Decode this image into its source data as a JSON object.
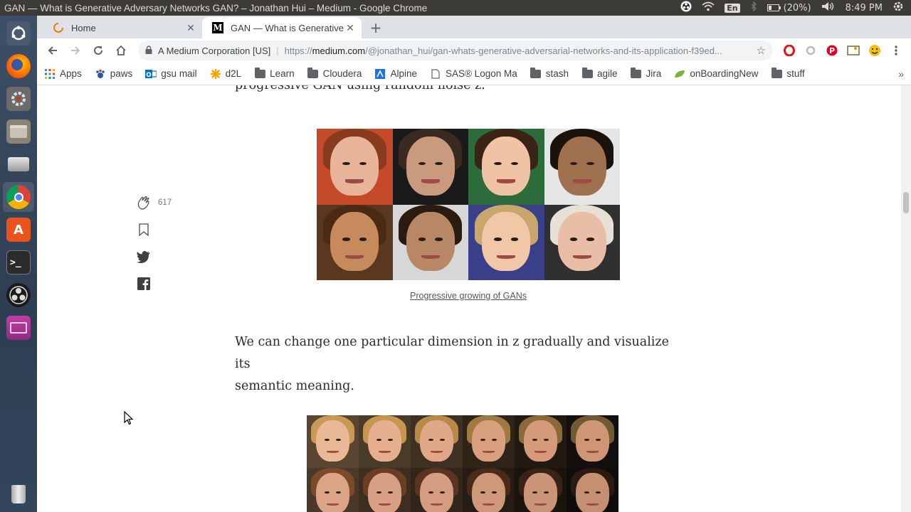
{
  "system": {
    "window_title": "GAN — What is Generative Adversary Networks GAN? – Jonathan Hui – Medium - Google Chrome",
    "language_indicator": "En",
    "battery": "(20%)",
    "clock": "8:49 PM"
  },
  "launcher": {
    "items": [
      "ubuntu-dash-icon",
      "firefox-icon",
      "system-settings-icon",
      "files-icon",
      "disks-icon",
      "chrome-icon",
      "software-center-icon",
      "terminal-icon",
      "obs-icon",
      "workspace-icon"
    ],
    "trash": "trash-icon"
  },
  "browser": {
    "tabs": [
      {
        "label": "Home",
        "active": false
      },
      {
        "label": "GAN — What is Generative Adversary Networks GAN?",
        "active": true
      }
    ],
    "new_tab": "+",
    "omnibox": {
      "cert": "A Medium Corporation [US]",
      "url_scheme": "https://",
      "url_host": "medium.com",
      "url_path": "/@jonathan_hui/gan-whats-generative-adversarial-networks-and-its-application-f39ed..."
    },
    "bookmarks": [
      {
        "label": "Apps",
        "icon": "apps-grid-icon"
      },
      {
        "label": "paws",
        "icon": "paws-icon"
      },
      {
        "label": "gsu mail",
        "icon": "outlook-icon"
      },
      {
        "label": "d2L",
        "icon": "d2l-icon"
      },
      {
        "label": "Learn",
        "icon": "folder-icon"
      },
      {
        "label": "Cloudera",
        "icon": "folder-icon"
      },
      {
        "label": "Alpine",
        "icon": "alpine-icon"
      },
      {
        "label": "SAS® Logon Ma",
        "icon": "page-icon"
      },
      {
        "label": "stash",
        "icon": "folder-icon"
      },
      {
        "label": "agile",
        "icon": "folder-icon"
      },
      {
        "label": "Jira",
        "icon": "folder-icon"
      },
      {
        "label": "onBoardingNew",
        "icon": "leaf-icon"
      },
      {
        "label": "stuff",
        "icon": "folder-icon"
      }
    ],
    "bookmarks_overflow": "»"
  },
  "article": {
    "text_top": "progressive GAN using random noise z.",
    "caption": "Progressive growing of GANs",
    "paragraph_line1": "We can change one particular dimension in z gradually and visualize its",
    "paragraph_line2": "semantic meaning."
  },
  "share_bar": {
    "clap_count": "617"
  },
  "colors": {
    "panel": "#3c3b37",
    "tabstrip": "#dee1e6",
    "launcher": "#2e3d52"
  }
}
